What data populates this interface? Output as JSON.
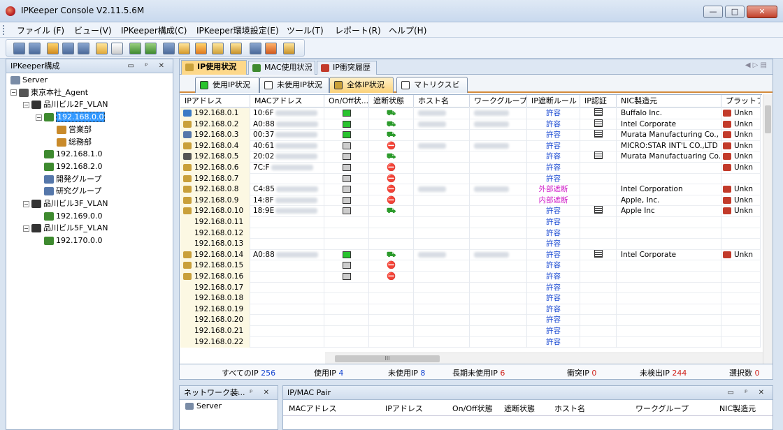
{
  "window": {
    "title": "IPKeeper Console V2.11.5.6M",
    "min": "—",
    "max": "□",
    "close": "✕"
  },
  "menu": [
    "ファイル (F)",
    "ビュー(V)",
    "IPKeeper構成(C)",
    "IPKeeper環境設定(E)",
    "ツール(T)",
    "レポート(R)",
    "ヘルプ(H)"
  ],
  "left_panel": {
    "title": "IPKeeper構成",
    "controls": "▭ ᵖ ✕",
    "tree": [
      {
        "label": "Server",
        "depth": 0,
        "expander": ""
      },
      {
        "label": "東京本社_Agent",
        "depth": 0,
        "expander": "−"
      },
      {
        "label": "品川ビル2F_VLAN",
        "depth": 1,
        "expander": "−"
      },
      {
        "label": "192.168.0.0",
        "depth": 2,
        "expander": "−",
        "selected": true
      },
      {
        "label": "営業部",
        "depth": 3,
        "expander": ""
      },
      {
        "label": "総務部",
        "depth": 3,
        "expander": ""
      },
      {
        "label": "192.168.1.0",
        "depth": 2,
        "expander": ""
      },
      {
        "label": "192.168.2.0",
        "depth": 2,
        "expander": ""
      },
      {
        "label": "開発グループ",
        "depth": 2,
        "expander": ""
      },
      {
        "label": "研究グループ",
        "depth": 2,
        "expander": ""
      },
      {
        "label": "品川ビル3F_VLAN",
        "depth": 1,
        "expander": "−"
      },
      {
        "label": "192.169.0.0",
        "depth": 2,
        "expander": ""
      },
      {
        "label": "品川ビル5F_VLAN",
        "depth": 1,
        "expander": "−"
      },
      {
        "label": "192.170.0.0",
        "depth": 2,
        "expander": ""
      }
    ]
  },
  "main_tabs": [
    "IP使用状況",
    "MAC使用状況",
    "IP衝突履歴"
  ],
  "sub_tabs": [
    "使用IP状況",
    "未使用IP状況",
    "全体IP状況",
    "マトリクスビュー"
  ],
  "nav_arrows": "◀ ▷ ▤",
  "columns": [
    "IPアドレス",
    "MACアドレス",
    "On/Off状...",
    "遮断状態",
    "ホスト名",
    "ワークグループ",
    "IP遮断ルール",
    "IP認証",
    "NIC製造元",
    "プラットフォ"
  ],
  "rows": [
    {
      "ip": "192.168.0.1",
      "mac": "10:6F",
      "onoff": "on",
      "block": "green",
      "rule": "許容",
      "auth": true,
      "nic": "Buffalo Inc.",
      "plat": "Unkn",
      "host": true
    },
    {
      "ip": "192.168.0.2",
      "mac": "A0:88",
      "onoff": "on",
      "block": "green",
      "rule": "許容",
      "auth": true,
      "nic": "Intel Corporate",
      "plat": "Unkn",
      "host": true
    },
    {
      "ip": "192.168.0.3",
      "mac": "00:37",
      "onoff": "on",
      "block": "green",
      "rule": "許容",
      "auth": true,
      "nic": "Murata Manufacturing Co., ...",
      "plat": "Unkn",
      "host": false
    },
    {
      "ip": "192.168.0.4",
      "mac": "40:61",
      "onoff": "off",
      "block": "red",
      "rule": "許容",
      "auth": false,
      "nic": "MICRO:STAR INT'L CO.,LTD",
      "plat": "Unkn",
      "host": true
    },
    {
      "ip": "192.168.0.5",
      "mac": "20:02",
      "onoff": "off",
      "block": "green",
      "rule": "許容",
      "auth": true,
      "nic": "Murata Manufactuaring Co.,...",
      "plat": "Unkn",
      "host": false
    },
    {
      "ip": "192.168.0.6",
      "mac": "7C:F",
      "onoff": "off",
      "block": "red",
      "rule": "許容",
      "auth": false,
      "nic": "",
      "plat": "Unkn",
      "host": false
    },
    {
      "ip": "192.168.0.7",
      "mac": "",
      "onoff": "off",
      "block": "red",
      "rule": "許容",
      "auth": false,
      "nic": "",
      "plat": "",
      "host": false
    },
    {
      "ip": "192.168.0.8",
      "mac": "C4:85",
      "onoff": "off",
      "block": "red",
      "rule": "外部遮断",
      "auth": false,
      "nic": "Intel Corporation",
      "plat": "Unkn",
      "host": true
    },
    {
      "ip": "192.168.0.9",
      "mac": "14:8F",
      "onoff": "off",
      "block": "red",
      "rule": "内部遮断",
      "auth": false,
      "nic": "Apple, Inc.",
      "plat": "Unkn",
      "host": false
    },
    {
      "ip": "192.168.0.10",
      "mac": "18:9E",
      "onoff": "off",
      "block": "green",
      "rule": "許容",
      "auth": true,
      "nic": "Apple Inc",
      "plat": "Unkn",
      "host": false
    },
    {
      "ip": "192.168.0.11",
      "mac": "",
      "onoff": "",
      "block": "",
      "rule": "許容",
      "auth": false,
      "nic": "",
      "plat": "",
      "host": false
    },
    {
      "ip": "192.168.0.12",
      "mac": "",
      "onoff": "",
      "block": "",
      "rule": "許容",
      "auth": false,
      "nic": "",
      "plat": "",
      "host": false
    },
    {
      "ip": "192.168.0.13",
      "mac": "",
      "onoff": "",
      "block": "",
      "rule": "許容",
      "auth": false,
      "nic": "",
      "plat": "",
      "host": false
    },
    {
      "ip": "192.168.0.14",
      "mac": "A0:88",
      "onoff": "on",
      "block": "green",
      "rule": "許容",
      "auth": true,
      "nic": "Intel Corporate",
      "plat": "Unkn",
      "host": true
    },
    {
      "ip": "192.168.0.15",
      "mac": "",
      "onoff": "off",
      "block": "red",
      "rule": "許容",
      "auth": false,
      "nic": "",
      "plat": "",
      "host": false
    },
    {
      "ip": "192.168.0.16",
      "mac": "",
      "onoff": "off",
      "block": "red",
      "rule": "許容",
      "auth": false,
      "nic": "",
      "plat": "",
      "host": false
    },
    {
      "ip": "192.168.0.17",
      "mac": "",
      "onoff": "",
      "block": "",
      "rule": "許容",
      "auth": false,
      "nic": "",
      "plat": "",
      "host": false
    },
    {
      "ip": "192.168.0.18",
      "mac": "",
      "onoff": "",
      "block": "",
      "rule": "許容",
      "auth": false,
      "nic": "",
      "plat": "",
      "host": false
    },
    {
      "ip": "192.168.0.19",
      "mac": "",
      "onoff": "",
      "block": "",
      "rule": "許容",
      "auth": false,
      "nic": "",
      "plat": "",
      "host": false
    },
    {
      "ip": "192.168.0.20",
      "mac": "",
      "onoff": "",
      "block": "",
      "rule": "許容",
      "auth": false,
      "nic": "",
      "plat": "",
      "host": false
    },
    {
      "ip": "192.168.0.21",
      "mac": "",
      "onoff": "",
      "block": "",
      "rule": "許容",
      "auth": false,
      "nic": "",
      "plat": "",
      "host": false
    },
    {
      "ip": "192.168.0.22",
      "mac": "",
      "onoff": "",
      "block": "",
      "rule": "許容",
      "auth": false,
      "nic": "",
      "plat": "",
      "host": false
    }
  ],
  "scroll_thumb_label": "III",
  "status": [
    {
      "label": "すべてのIP",
      "value": "256"
    },
    {
      "label": "使用IP",
      "value": "4"
    },
    {
      "label": "未使用IP",
      "value": "8"
    },
    {
      "label": "長期未使用IP",
      "value": "6"
    },
    {
      "label": "衝突IP",
      "value": "0"
    },
    {
      "label": "未検出IP",
      "value": "244"
    },
    {
      "label": "選択数",
      "value": "0"
    }
  ],
  "bottom_left": {
    "title": "ネットワーク装...",
    "controls": "▭ ᵖ ✕",
    "item": "Server"
  },
  "bottom_right": {
    "title": "IP/MAC Pair",
    "controls": "▭ ᵖ ✕",
    "columns": [
      "MACアドレス",
      "IPアドレス",
      "On/Off状態",
      "遮断状態",
      "ホスト名",
      "ワークグループ",
      "NIC製造元"
    ]
  },
  "colors": {
    "accent": "#fdd88a",
    "allow": "#1747d1",
    "block": "#d01cc8",
    "value_blue": "#1747d1",
    "value_red": "#d0231c"
  }
}
